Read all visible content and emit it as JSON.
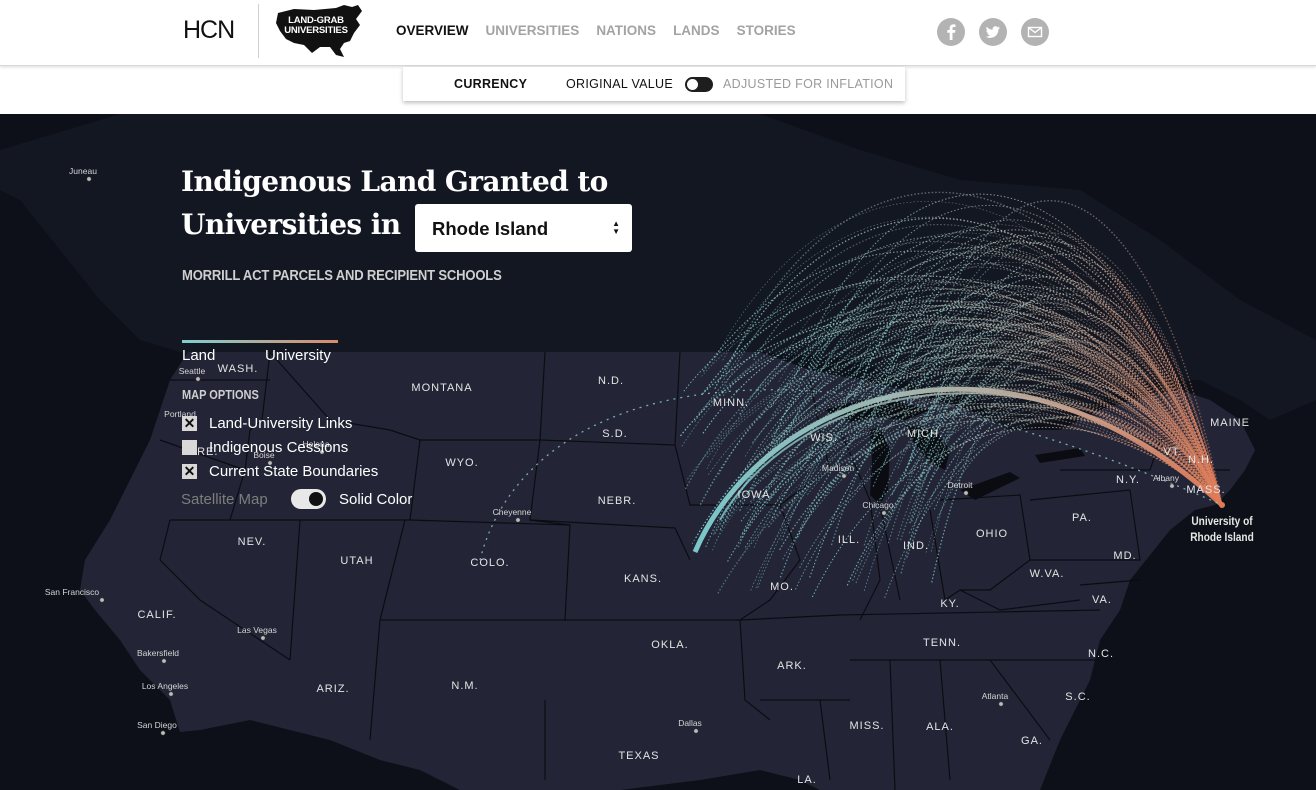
{
  "header": {
    "brand": "HCN",
    "logo_text": "LAND-GRAB UNIVERSITIES",
    "nav": [
      {
        "label": "OVERVIEW",
        "active": true
      },
      {
        "label": "UNIVERSITIES",
        "active": false
      },
      {
        "label": "NATIONS",
        "active": false
      },
      {
        "label": "LANDS",
        "active": false
      },
      {
        "label": "STORIES",
        "active": false
      }
    ],
    "social_icons": [
      "facebook-icon",
      "twitter-icon",
      "email-icon"
    ]
  },
  "currency": {
    "label": "CURRENCY",
    "original": "ORIGINAL VALUE",
    "adjusted": "ADJUSTED FOR INFLATION",
    "adjusted_selected": false
  },
  "hero": {
    "title_line1": "Indigenous Land Granted to",
    "title_line2": "Universities in",
    "selected_state": "Rhode Island",
    "subtitle": "MORRILL ACT PARCELS AND RECIPIENT SCHOOLS"
  },
  "legend": {
    "land": "Land",
    "university": "University",
    "color_land": "#7ecfd1",
    "color_university": "#d98b6a"
  },
  "map_options": {
    "heading": "MAP OPTIONS",
    "options": [
      {
        "label": "Land-University Links",
        "checked": true
      },
      {
        "label": "Indigenous Cessions",
        "checked": false
      },
      {
        "label": "Current State Boundaries",
        "checked": true
      }
    ],
    "satellite_label": "Satellite Map",
    "solid_label": "Solid Color",
    "solid_selected": true
  },
  "map": {
    "states": [
      "WASH.",
      "MONTANA",
      "N.D.",
      "MINN.",
      "ORE.",
      "S.D.",
      "WYO.",
      "WIS.",
      "MICH.",
      "NEBR.",
      "IOWA",
      "NEV.",
      "UTAH",
      "COLO.",
      "KANS.",
      "ILL.",
      "IND.",
      "OHIO",
      "PA.",
      "N.Y.",
      "VT.",
      "N.H.",
      "MAINE",
      "MASS.",
      "CALIF.",
      "MO.",
      "W.VA.",
      "MD.",
      "VA.",
      "KY.",
      "OKLA.",
      "TENN.",
      "N.C.",
      "ARIZ.",
      "N.M.",
      "ARK.",
      "S.C.",
      "MISS.",
      "ALA.",
      "GA.",
      "TEXAS",
      "LA."
    ],
    "cities": [
      "Juneau",
      "Seattle",
      "Portland",
      "Boise",
      "Helena",
      "Cheyenne",
      "Madison",
      "Chicago",
      "Detroit",
      "Albany",
      "San Francisco",
      "Las Vegas",
      "Bakersfield",
      "Los Angeles",
      "San Diego",
      "Dallas",
      "Atlanta"
    ],
    "university_label_line1": "University of",
    "university_label_line2": "Rhode Island"
  }
}
